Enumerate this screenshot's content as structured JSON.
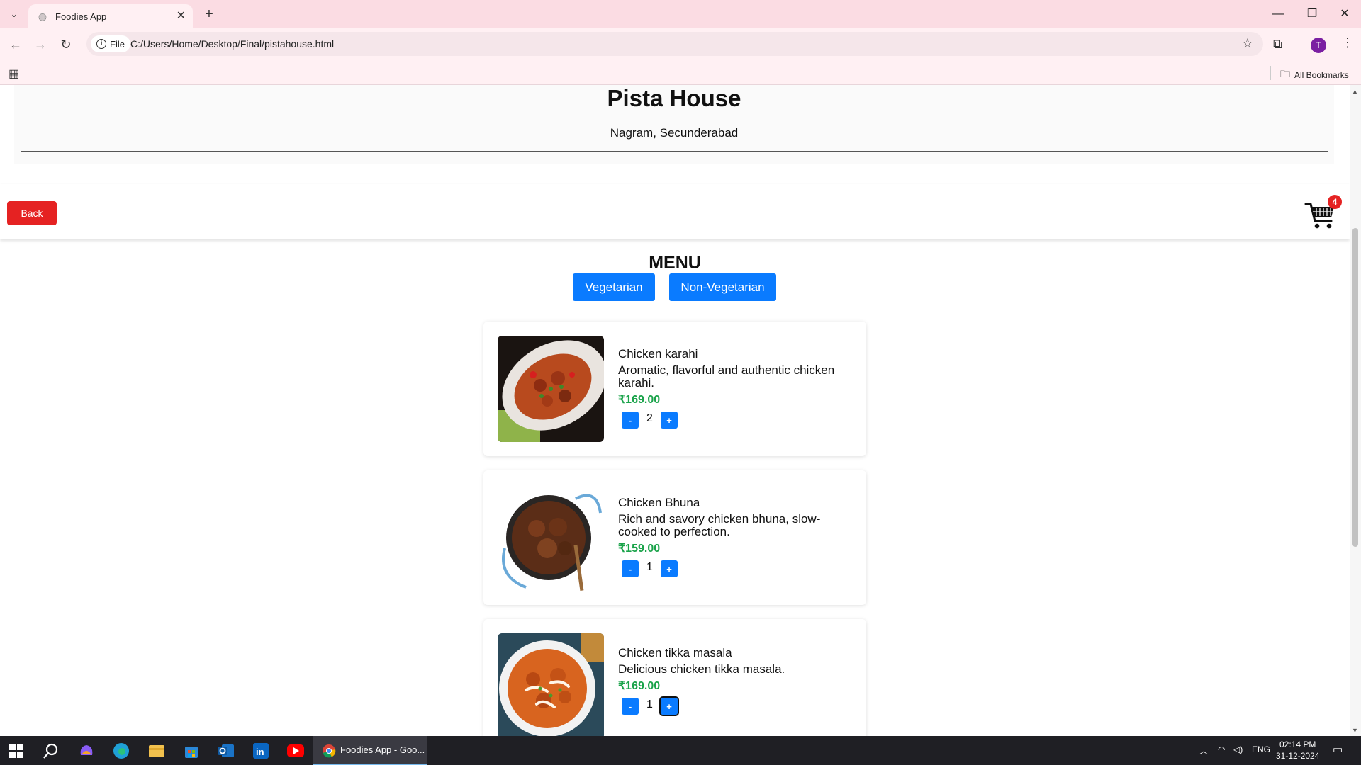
{
  "browser": {
    "tab_title": "Foodies App",
    "url_label": "File",
    "url": "C:/Users/Home/Desktop/Final/pistahouse.html",
    "profile_initial": "T",
    "all_bookmarks": "All Bookmarks"
  },
  "restaurant": {
    "name": "Pista House",
    "location": "Nagram, Secunderabad"
  },
  "actions": {
    "back_label": "Back",
    "cart_count": "4"
  },
  "menu": {
    "title": "MENU",
    "categories": [
      "Vegetarian",
      "Non-Vegetarian"
    ],
    "items": [
      {
        "name": "Chicken karahi",
        "description": "Aromatic, flavorful and authentic chicken karahi.",
        "price": "₹169.00",
        "quantity": "2"
      },
      {
        "name": "Chicken Bhuna",
        "description": "Rich and savory chicken bhuna, slow-cooked to perfection.",
        "price": "₹159.00",
        "quantity": "1"
      },
      {
        "name": "Chicken tikka masala",
        "description": "Delicious chicken tikka masala.",
        "price": "₹169.00",
        "quantity": "1"
      }
    ],
    "minus_label": "-",
    "plus_label": "+"
  },
  "taskbar": {
    "active_window": "Foodies App - Goo...",
    "language": "ENG",
    "time": "02:14 PM",
    "date": "31-12-2024"
  },
  "colors": {
    "accent_blue": "#0a7bff",
    "danger_red": "#e52222",
    "price_green": "#1aa34a"
  }
}
